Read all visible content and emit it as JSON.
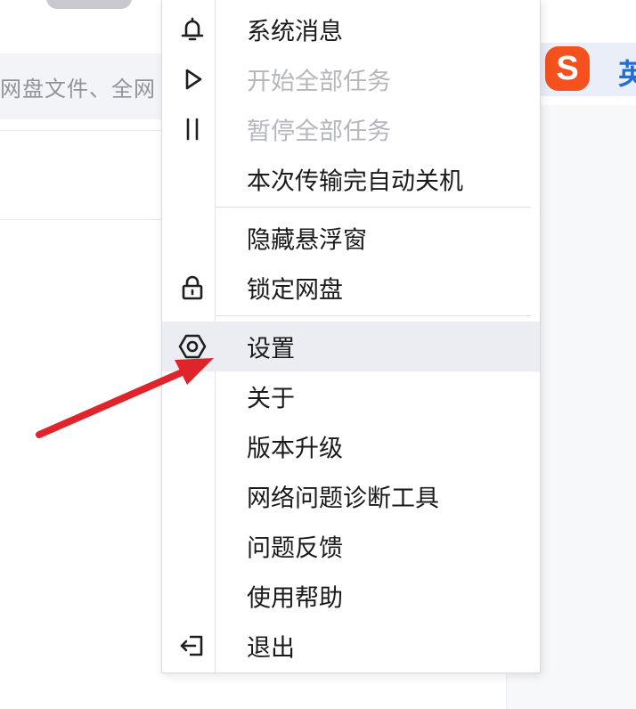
{
  "background": {
    "search_hint": "网盘文件、全网"
  },
  "menu": {
    "items": [
      {
        "label": "系统消息",
        "icon": "bell-icon",
        "enabled": true
      },
      {
        "label": "开始全部任务",
        "icon": "play-icon",
        "enabled": false
      },
      {
        "label": "暂停全部任务",
        "icon": "pause-icon",
        "enabled": false
      },
      {
        "label": "本次传输完自动关机",
        "icon": "",
        "enabled": true
      },
      {
        "label": "隐藏悬浮窗",
        "icon": "",
        "enabled": true
      },
      {
        "label": "锁定网盘",
        "icon": "lock-icon",
        "enabled": true
      },
      {
        "label": "设置",
        "icon": "gear-icon",
        "enabled": true,
        "highlighted": true
      },
      {
        "label": "关于",
        "icon": "",
        "enabled": true
      },
      {
        "label": "版本升级",
        "icon": "",
        "enabled": true
      },
      {
        "label": "网络问题诊断工具",
        "icon": "",
        "enabled": true
      },
      {
        "label": "问题反馈",
        "icon": "",
        "enabled": true
      },
      {
        "label": "使用帮助",
        "icon": "",
        "enabled": true
      },
      {
        "label": "退出",
        "icon": "exit-icon",
        "enabled": true
      }
    ]
  },
  "colors": {
    "annotation_arrow": "#e0242b",
    "sogou_brand": "#f4511e",
    "disabled_text": "#b5b7bd",
    "highlight_row": "#ecedf3"
  },
  "sogou": {
    "logo_letter": "S",
    "side_text": "英"
  }
}
